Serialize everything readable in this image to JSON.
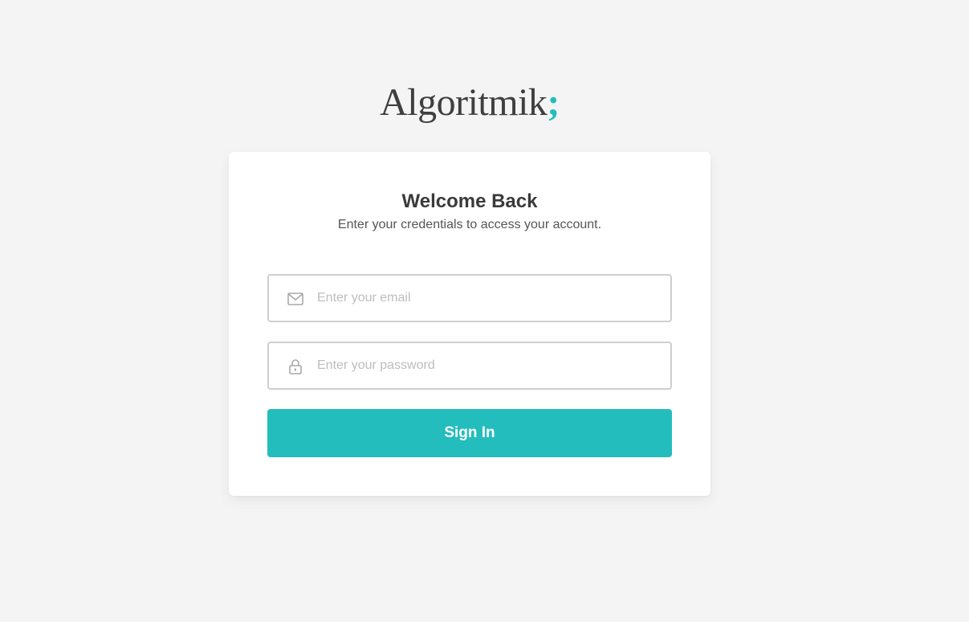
{
  "brand": {
    "name": "Algoritmik",
    "mark": ";",
    "accent_color": "#23bdbd"
  },
  "login": {
    "title": "Welcome Back",
    "subtitle": "Enter your credentials to access your account.",
    "email": {
      "icon": "mail-icon",
      "placeholder": "Enter your email",
      "value": ""
    },
    "password": {
      "icon": "lock-icon",
      "placeholder": "Enter your password",
      "value": ""
    },
    "submit_label": "Sign In"
  }
}
